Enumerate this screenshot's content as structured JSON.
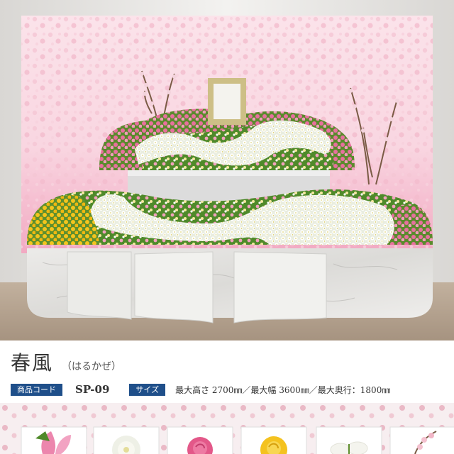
{
  "product": {
    "name": "春風",
    "reading": "（はるかぜ）",
    "code_label": "商品コード",
    "code": "SP-09",
    "size_label": "サイズ",
    "size_text": "最大高さ 2700㎜／最大幅 3600㎜／最大奥行：1800㎜"
  },
  "colors": {
    "accent": "#1f4f8a",
    "backdrop_pink": "#f6c9d6",
    "floor": "#b7a591",
    "marble": "#e6e5e3"
  },
  "thumbnails": [
    {
      "icon": "lily-icon",
      "color": "#ec86ad"
    },
    {
      "icon": "chrysanthemum-icon",
      "color": "#f1f1ea"
    },
    {
      "icon": "rose-icon",
      "color": "#e35889"
    },
    {
      "icon": "yellow-rose-icon",
      "color": "#f4c21f"
    },
    {
      "icon": "white-flower-icon",
      "color": "#f8f8f2"
    },
    {
      "icon": "cherry-blossom-icon",
      "color": "#f3c1cf"
    }
  ]
}
